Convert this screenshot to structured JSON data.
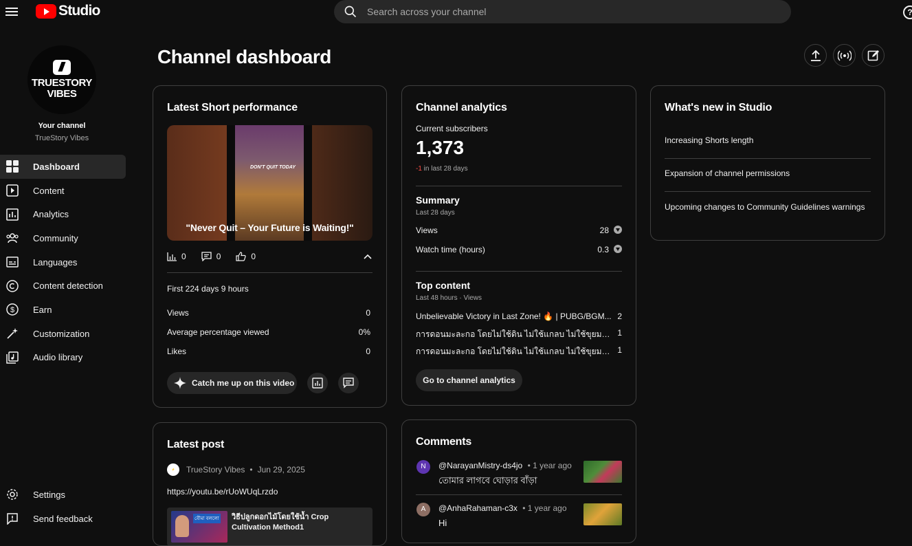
{
  "app": {
    "title": "Studio",
    "brand_color": "#ff0000"
  },
  "search": {
    "placeholder": "Search across your channel"
  },
  "header": {
    "page_title": "Channel dashboard",
    "help_glyph": "?"
  },
  "channel": {
    "your_channel_label": "Your channel",
    "name": "TrueStory Vibes",
    "avatar_line1": "TRUESTORY",
    "avatar_line2": "VIBES"
  },
  "nav": {
    "items": [
      {
        "label": "Dashboard",
        "icon": "dashboard-icon",
        "active": true
      },
      {
        "label": "Content",
        "icon": "content-icon"
      },
      {
        "label": "Analytics",
        "icon": "analytics-icon"
      },
      {
        "label": "Community",
        "icon": "community-icon"
      },
      {
        "label": "Languages",
        "icon": "languages-icon"
      },
      {
        "label": "Content detection",
        "icon": "copyright-icon"
      },
      {
        "label": "Earn",
        "icon": "dollar-icon"
      },
      {
        "label": "Customization",
        "icon": "magic-wand-icon"
      },
      {
        "label": "Audio library",
        "icon": "audio-library-icon"
      }
    ],
    "bottom": [
      {
        "label": "Settings",
        "icon": "gear-icon"
      },
      {
        "label": "Send feedback",
        "icon": "feedback-icon"
      }
    ]
  },
  "latest_short": {
    "title": "Latest Short performance",
    "thumb_overlay": "DON'T QUIT TODAY",
    "caption": "\"Never Quit – Your Future is Waiting!\"",
    "views_count": "0",
    "comments_count": "0",
    "likes_count": "0",
    "period": "First 224 days 9 hours",
    "metrics": [
      {
        "label": "Views",
        "value": "0"
      },
      {
        "label": "Average percentage viewed",
        "value": "0%"
      },
      {
        "label": "Likes",
        "value": "0"
      }
    ],
    "catch_up_label": "Catch me up on this video"
  },
  "analytics": {
    "title": "Channel analytics",
    "subs_label": "Current subscribers",
    "subs_value": "1,373",
    "subs_delta": "-1",
    "subs_delta_suffix": " in last 28 days",
    "summary_title": "Summary",
    "summary_sub": "Last 28 days",
    "summary": [
      {
        "label": "Views",
        "value": "28"
      },
      {
        "label": "Watch time (hours)",
        "value": "0.3"
      }
    ],
    "top_title": "Top content",
    "top_sub": "Last 48 hours · Views",
    "top": [
      {
        "title": "Unbelievable Victory in Last Zone! 🔥 | PUBG/BGM...",
        "views": "2"
      },
      {
        "title": "การดอนมะละกอ โดยไม่ใช้ดิน ไม่ใช้แกลบ ไม่ใช้ขุยมะพร้...",
        "views": "1"
      },
      {
        "title": "การดอนมะละกอ โดยไม่ใช้ดิน ไม่ใช้แกลบ ไม่ใช้ขุยมะพร้...",
        "views": "1"
      }
    ],
    "cta": "Go to channel analytics"
  },
  "whats_new": {
    "title": "What's new in Studio",
    "items": [
      "Increasing Shorts length",
      "Expansion of channel permissions",
      "Upcoming changes to Community Guidelines warnings"
    ]
  },
  "latest_post": {
    "title": "Latest post",
    "author": "TrueStory Vibes",
    "dot": "•",
    "date": "Jun 29, 2025",
    "link": "https://youtu.be/rUoWUqLrzdo",
    "embed_label": "বৌমা বললো",
    "embed_title": "วิธีปลูกดอกไม้โดยใช้น้ำ Crop Cultivation Method1"
  },
  "comments": {
    "title": "Comments",
    "items": [
      {
        "avatar": "N",
        "avatar_color": "#5e35b1",
        "author": "@NarayanMistry-ds4jo",
        "ago": "• 1 year ago",
        "text": "তোমার লাগবে ঘোড়ার বাঁড়া"
      },
      {
        "avatar": "A",
        "avatar_color": "#8d6e63",
        "author": "@AnhaRahaman-c3x",
        "ago": "• 1 year ago",
        "text": "Hi"
      }
    ]
  }
}
